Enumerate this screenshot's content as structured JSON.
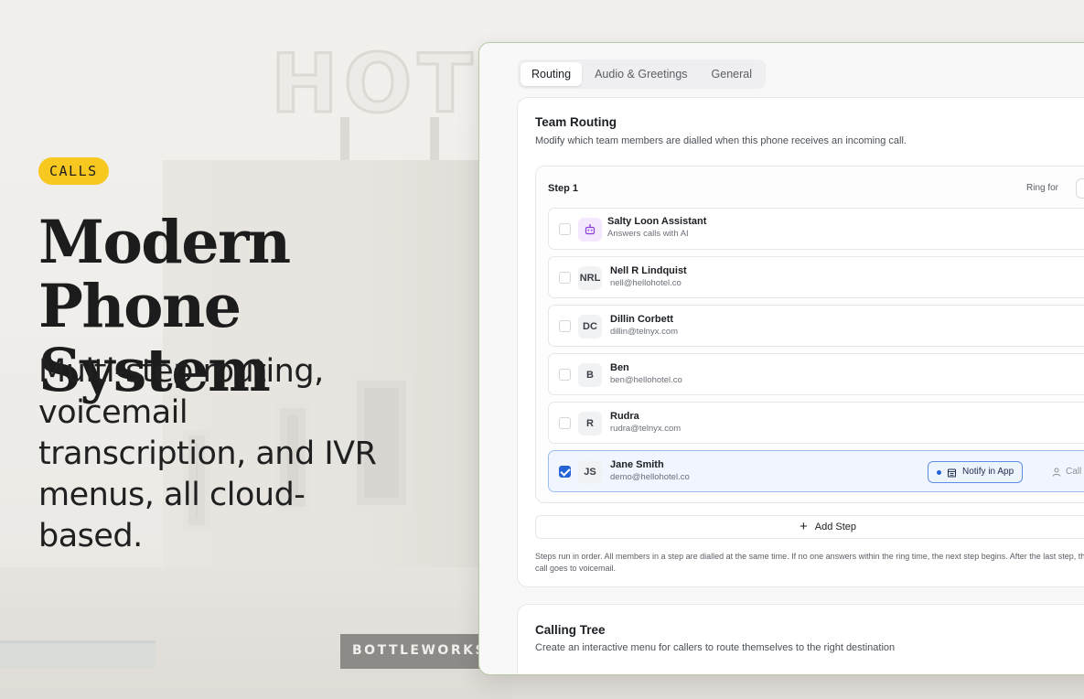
{
  "background": {
    "sign": "HOT",
    "storefront": "BOTTLEWORKS"
  },
  "hero": {
    "badge": "CALLS",
    "headline": "Modern Phone System",
    "subtext": "Multi-step routing, voicemail transcription, and IVR menus, all cloud-based."
  },
  "colors": {
    "badge": "#f7c81f",
    "accent": "#2563d6",
    "ai_avatar": "#f3e8fd"
  },
  "tabs": [
    {
      "label": "Routing",
      "active": true
    },
    {
      "label": "Audio & Greetings",
      "active": false
    },
    {
      "label": "General",
      "active": false
    }
  ],
  "team_routing": {
    "title": "Team Routing",
    "description": "Modify which team members are dialled when this phone receives an incoming call.",
    "step": {
      "label": "Step 1",
      "ring_for_label": "Ring for",
      "members": [
        {
          "initials": "",
          "icon": "robot-icon",
          "name": "Salty Loon Assistant",
          "sub": "Answers calls with AI",
          "checked": false
        },
        {
          "initials": "NRL",
          "name": "Nell R Lindquist",
          "sub": "nell@hellohotel.co",
          "checked": false
        },
        {
          "initials": "DC",
          "name": "Dillin Corbett",
          "sub": "dillin@telnyx.com",
          "checked": false
        },
        {
          "initials": "B",
          "name": "Ben",
          "sub": "ben@hellohotel.co",
          "checked": false
        },
        {
          "initials": "R",
          "name": "Rudra",
          "sub": "rudra@telnyx.com",
          "checked": false
        },
        {
          "initials": "JS",
          "name": "Jane Smith",
          "sub": "demo@hellohotel.co",
          "checked": true,
          "notify_label": "Notify in App",
          "call_label": "Call"
        }
      ]
    },
    "add_step_label": "Add Step",
    "note": "Steps run in order. All members in a step are dialled at the same time. If no one answers within the ring time, the next step begins. After the last step, the call goes to voicemail."
  },
  "calling_tree": {
    "title": "Calling Tree",
    "description": "Create an interactive menu for callers to route themselves to the right destination"
  }
}
